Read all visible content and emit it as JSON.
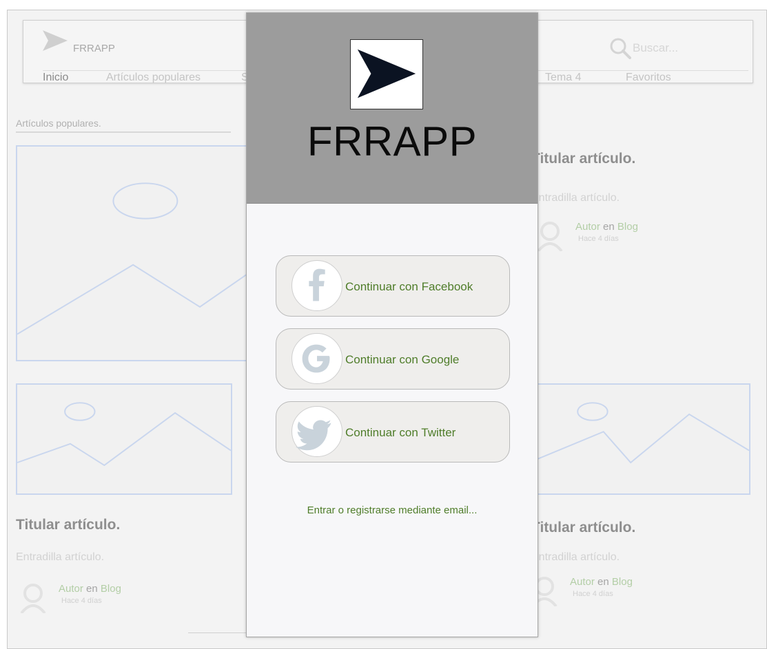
{
  "navbar": {
    "brand": "FRRAPP",
    "search_placeholder": "Buscar...",
    "links": [
      "Inicio",
      "Artículos populares",
      "S",
      "Tema 4",
      "Favoritos"
    ]
  },
  "section": {
    "title": "Artículos populares."
  },
  "articles": [
    {
      "headline": "Titular artículo.",
      "lead": "Entradilla artículo.",
      "author": "Autor",
      "connector": "en",
      "blog": "Blog",
      "time": "Hace 4 días"
    },
    {
      "headline": "Titular artículo.",
      "lead": "Entradilla artículo.",
      "author": "Autor",
      "connector": "en",
      "blog": "Blog",
      "time": "Hace 4 días"
    },
    {
      "headline": "Titular artículo.",
      "lead": "Entradilla artículo.",
      "author": "Autor",
      "connector": "en",
      "blog": "Blog",
      "time": "Hace 4 días"
    }
  ],
  "modal": {
    "brand": "FRRAPP",
    "buttons": [
      {
        "label": "Continuar con Facebook",
        "icon": "facebook-icon"
      },
      {
        "label": "Continuar con Google",
        "icon": "google-icon"
      },
      {
        "label": "Continuar con Twitter",
        "icon": "twitter-icon"
      }
    ],
    "email_link": "Entrar o registrarse mediante email..."
  },
  "colors": {
    "header_gray": "#9c9c9c",
    "link_green": "#4f7d2a",
    "placeholder_blue": "#c9d6ee",
    "button_bg": "#efeeec"
  }
}
